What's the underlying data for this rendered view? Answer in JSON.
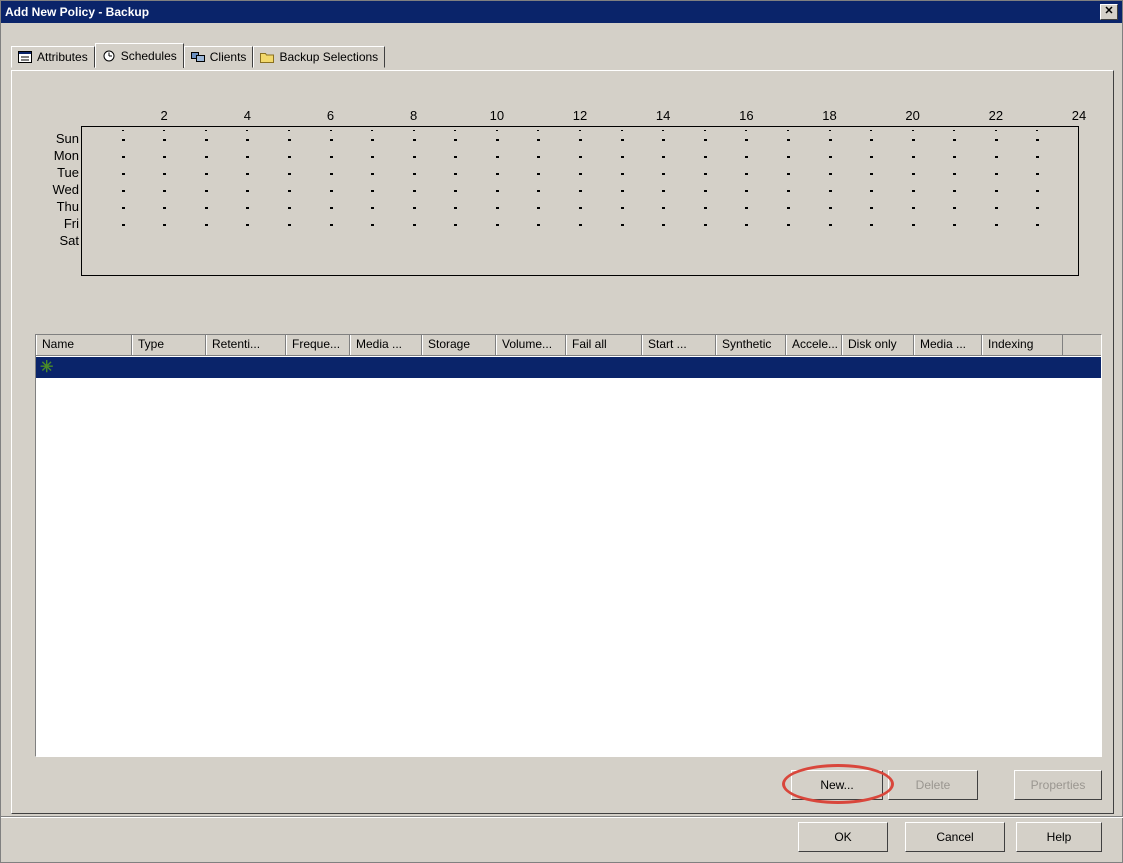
{
  "window": {
    "title": "Add New Policy - Backup",
    "close_glyph": "✕"
  },
  "tabs": [
    {
      "label": "Attributes",
      "icon": "attributes-icon"
    },
    {
      "label": "Schedules",
      "icon": "schedules-icon",
      "active": true
    },
    {
      "label": "Clients",
      "icon": "clients-icon"
    },
    {
      "label": "Backup Selections",
      "icon": "folder-icon"
    }
  ],
  "schedule_chart": {
    "hours": [
      "2",
      "4",
      "6",
      "8",
      "10",
      "12",
      "14",
      "16",
      "18",
      "20",
      "22",
      "24"
    ],
    "days": [
      "Sun",
      "Mon",
      "Tue",
      "Wed",
      "Thu",
      "Fri",
      "Sat"
    ]
  },
  "table": {
    "columns": [
      "Name",
      "Type",
      "Retenti...",
      "Freque...",
      "Media ...",
      "Storage",
      "Volume...",
      "Fail all",
      "Start ...",
      "Synthetic",
      "Accele...",
      "Disk only",
      "Media ...",
      "Indexing"
    ],
    "new_row_icon": "new-item-icon"
  },
  "buttons": {
    "new": "New...",
    "delete": "Delete",
    "properties": "Properties",
    "ok": "OK",
    "cancel": "Cancel",
    "help": "Help"
  },
  "colors": {
    "selection": "#0a246a",
    "highlight_circle": "#d9463b"
  }
}
